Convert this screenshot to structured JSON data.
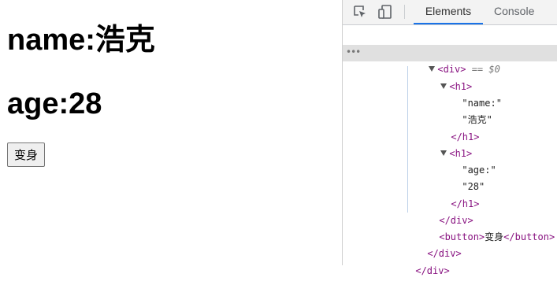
{
  "page": {
    "name_label": "name:浩克",
    "age_label": "age:28",
    "button_label": "变身"
  },
  "devtools": {
    "tabs": [
      "Elements",
      "Console"
    ],
    "selected_suffix": " == $0",
    "ellipsis": "•••",
    "tree": {
      "div_open": "<div>",
      "div_close": "</div>",
      "h1_open": "<h1>",
      "h1_close": "</h1>",
      "text_name_key": "\"name:\"",
      "text_name_val": "\"浩克\"",
      "text_age_key": "\"age:\"",
      "text_age_val": "\"28\"",
      "button_open": "<button>",
      "button_text": "变身",
      "button_close": "</button>"
    }
  }
}
